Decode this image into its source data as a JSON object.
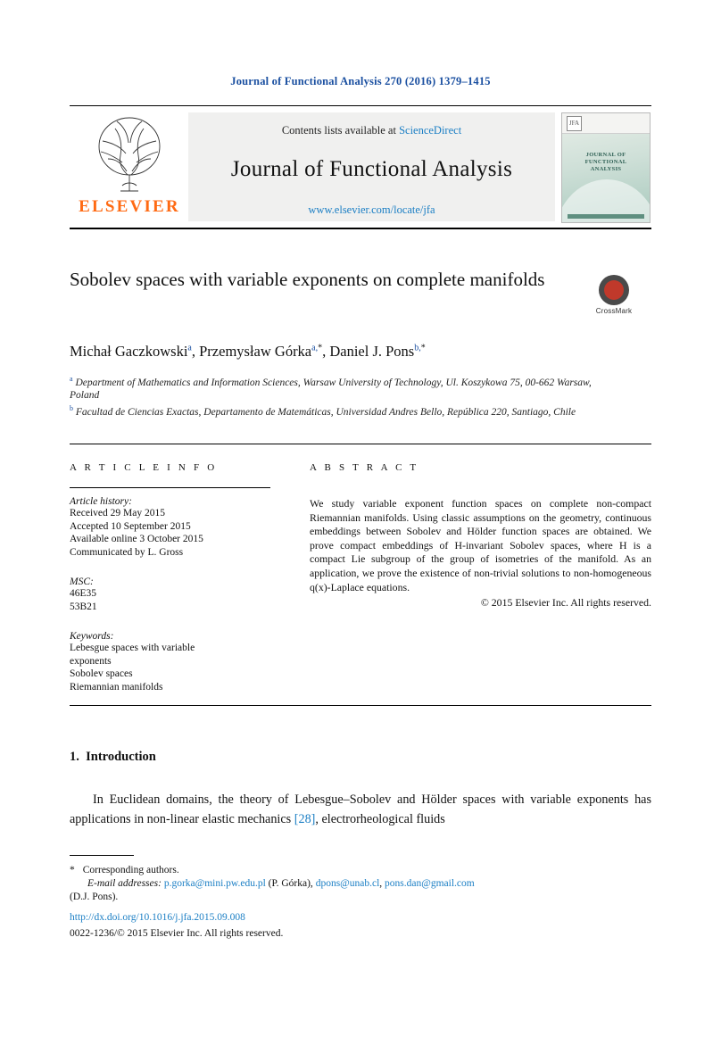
{
  "journal_ref": "Journal of Functional Analysis 270 (2016) 1379–1415",
  "masthead": {
    "contents_prefix": "Contents lists available at",
    "contents_link": "ScienceDirect",
    "journal_title": "Journal of Functional Analysis",
    "journal_url": "www.elsevier.com/locate/jfa",
    "publisher": "ELSEVIER",
    "cover": {
      "badge": "JFA",
      "title_lines": [
        "JOURNAL OF",
        "FUNCTIONAL",
        "ANALYSIS"
      ]
    }
  },
  "article": {
    "title": "Sobolev spaces with variable exponents on complete manifolds",
    "crossmark_label": "CrossMark",
    "authors_html": "Michał Gaczkowski<sup>a</sup>, Przemysław Górka<sup>a,</sup><sup class=\"plain\">*</sup>, Daniel J. Pons<sup>b,</sup><sup class=\"plain\">*</sup>",
    "affiliations": [
      {
        "marker": "a",
        "text": "Department of Mathematics and Information Sciences, Warsaw University of Technology, Ul. Koszykowa 75, 00-662 Warsaw, Poland"
      },
      {
        "marker": "b",
        "text": "Facultad de Ciencias Exactas, Departamento de Matemáticas, Universidad Andres Bello, República 220, Santiago, Chile"
      }
    ]
  },
  "article_info": {
    "heading": "A R T I C L E   I N F O",
    "history_label": "Article history:",
    "history": [
      "Received 29 May 2015",
      "Accepted 10 September 2015",
      "Available online 3 October 2015",
      "Communicated by L. Gross"
    ],
    "msc_label": "MSC:",
    "msc": [
      "46E35",
      "53B21"
    ],
    "keywords_label": "Keywords:",
    "keywords": [
      "Lebesgue spaces with variable",
      "exponents",
      "Sobolev spaces",
      "Riemannian manifolds"
    ]
  },
  "abstract": {
    "heading": "A B S T R A C T",
    "text": "We study variable exponent function spaces on complete non-compact Riemannian manifolds. Using classic assumptions on the geometry, continuous embeddings between Sobolev and Hölder function spaces are obtained. We prove compact embeddings of H-invariant Sobolev spaces, where H is a compact Lie subgroup of the group of isometries of the manifold. As an application, we prove the existence of non-trivial solutions to non-homogeneous q(x)-Laplace equations.",
    "copyright": "© 2015 Elsevier Inc. All rights reserved."
  },
  "body": {
    "section_number": "1.",
    "section_title": "Introduction",
    "paragraph_pre": "In Euclidean domains, the theory of Lebesgue–Sobolev and Hölder spaces with variable exponents has applications in non-linear elastic mechanics ",
    "paragraph_ref": "[28]",
    "paragraph_post": ", electrorheological fluids"
  },
  "footnotes": {
    "corresponding": "Corresponding authors.",
    "email_label": "E-mail addresses:",
    "emails": [
      {
        "address": "p.gorka@mini.pw.edu.pl",
        "owner": "(P. Górka)"
      },
      {
        "address": "dpons@unab.cl",
        "owner": ""
      },
      {
        "address": "pons.dan@gmail.com",
        "owner": ""
      }
    ],
    "email_tail": "(D.J. Pons).",
    "doi": "http://dx.doi.org/10.1016/j.jfa.2015.09.008",
    "issn_copyright": "0022-1236/© 2015 Elsevier Inc. All rights reserved."
  },
  "colors": {
    "link": "#1a7ec4",
    "journal_ref": "#1a4fa0",
    "elsevier_orange": "#ff6a13",
    "crossmark_red": "#c0392b"
  }
}
